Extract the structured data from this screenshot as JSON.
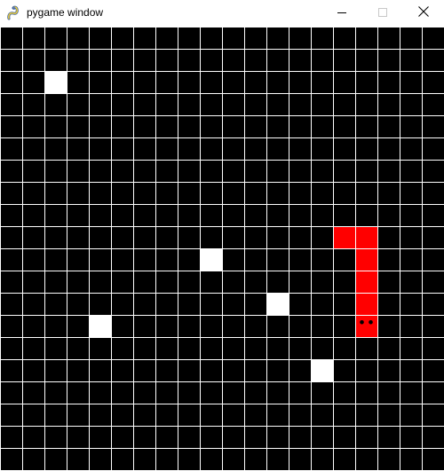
{
  "window": {
    "title": "pygame window",
    "app_icon": "pygame-snake-icon",
    "controls": [
      {
        "name": "minimize-button",
        "icon": "minimize-icon"
      },
      {
        "name": "maximize-button",
        "icon": "maximize-icon"
      },
      {
        "name": "close-button",
        "icon": "close-icon"
      }
    ]
  },
  "game": {
    "grid": {
      "columns": 20,
      "rows": 20
    },
    "colors": {
      "background": "#000000",
      "grid_line": "#ffffff",
      "snake": "#ff0000",
      "food": "#ffffff",
      "eyes": "#000000"
    },
    "snake": {
      "head": {
        "col": 16,
        "row": 13
      },
      "direction": "down",
      "segments": [
        {
          "col": 16,
          "row": 13
        },
        {
          "col": 16,
          "row": 12
        },
        {
          "col": 16,
          "row": 11
        },
        {
          "col": 16,
          "row": 10
        },
        {
          "col": 16,
          "row": 9
        },
        {
          "col": 15,
          "row": 9
        }
      ]
    },
    "food": [
      {
        "col": 2,
        "row": 2
      },
      {
        "col": 9,
        "row": 10
      },
      {
        "col": 12,
        "row": 12
      },
      {
        "col": 4,
        "row": 13
      },
      {
        "col": 14,
        "row": 15
      }
    ]
  }
}
